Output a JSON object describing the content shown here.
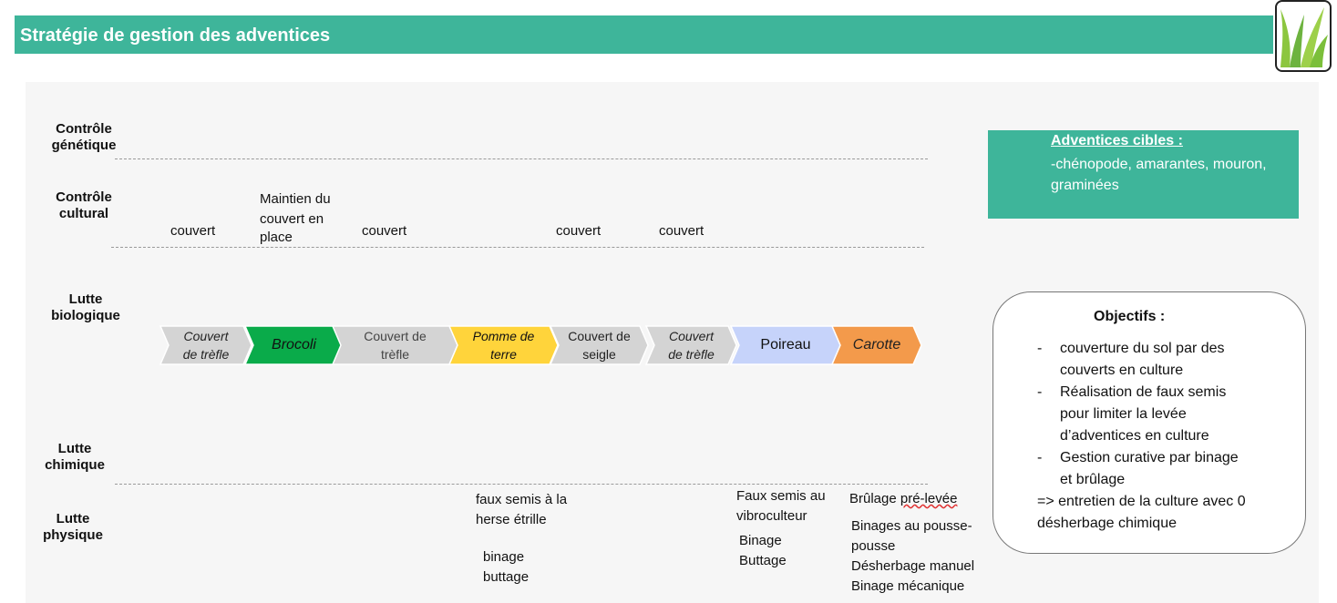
{
  "header": {
    "title": "Stratégie de gestion des adventices"
  },
  "rows": {
    "genetic": [
      "Contrôle",
      "génétique"
    ],
    "cultural": [
      "Contrôle",
      "cultural"
    ],
    "biological": [
      "Lutte",
      "biologique"
    ],
    "chemical": [
      "Lutte",
      "chimique"
    ],
    "physical": [
      "Lutte",
      "physique"
    ]
  },
  "cultural_notes": {
    "n1": "couvert",
    "n2": [
      "Maintien du",
      "couvert en",
      "place"
    ],
    "n3": "couvert",
    "n4": "couvert",
    "n5": "couvert"
  },
  "rotation": [
    {
      "lines": [
        "Couvert",
        "de trèfle"
      ],
      "fill": "#d4d4d4",
      "text_color": "#222222",
      "italic": true
    },
    {
      "lines": [
        "Brocoli"
      ],
      "fill": "#0aab4a",
      "text_color": "#111111",
      "italic": true
    },
    {
      "lines": [
        "Couvert de",
        "trèfle"
      ],
      "fill": "#d4d4d4",
      "text_color": "#444444",
      "italic": false
    },
    {
      "lines": [
        "Pomme de",
        "terre"
      ],
      "fill": "#ffd43b",
      "text_color": "#111111",
      "italic": true
    },
    {
      "lines": [
        "Couvert de",
        "seigle"
      ],
      "fill": "#d4d4d4",
      "text_color": "#222222",
      "italic": false
    },
    {
      "lines": [
        "Couvert",
        "de trèfle"
      ],
      "fill": "#d4d4d4",
      "text_color": "#222222",
      "italic": true
    },
    {
      "lines": [
        "Poireau"
      ],
      "fill": "#c6d3fa",
      "text_color": "#111111",
      "italic": false
    },
    {
      "lines": [
        "Carotte"
      ],
      "fill": "#f39a4b",
      "text_color": "#222222",
      "italic": true
    }
  ],
  "physical_notes": {
    "faux_semis_herse": [
      "faux semis à la",
      "herse étrille"
    ],
    "binage_buttage": [
      "binage",
      "buttage"
    ],
    "faux_semis_vibro": [
      "Faux semis au",
      "vibroculteur"
    ],
    "binage_buttage_2": [
      "Binage",
      "Buttage"
    ],
    "brulage": [
      "Brûlage ",
      "pré-levée"
    ],
    "carotte_list": [
      "Binages au pousse-",
      "pousse",
      "Désherbage manuel",
      "Binage mécanique"
    ]
  },
  "targets": {
    "title": "Adventices cibles :",
    "text": "-chénopode, amarantes, mouron, graminées"
  },
  "objectives": {
    "title": "Objectifs :",
    "items": [
      [
        "couverture du sol par des",
        "couverts en culture"
      ],
      [
        "Réalisation de faux semis",
        "pour limiter la levée",
        "d’adventices en culture"
      ],
      [
        "Gestion curative par binage",
        "et brûlage"
      ]
    ],
    "bullet": "-",
    "conclusion": [
      "=> entretien de la culture avec 0",
      "désherbage chimique"
    ]
  },
  "colors": {
    "accent": "#3eb59a"
  }
}
